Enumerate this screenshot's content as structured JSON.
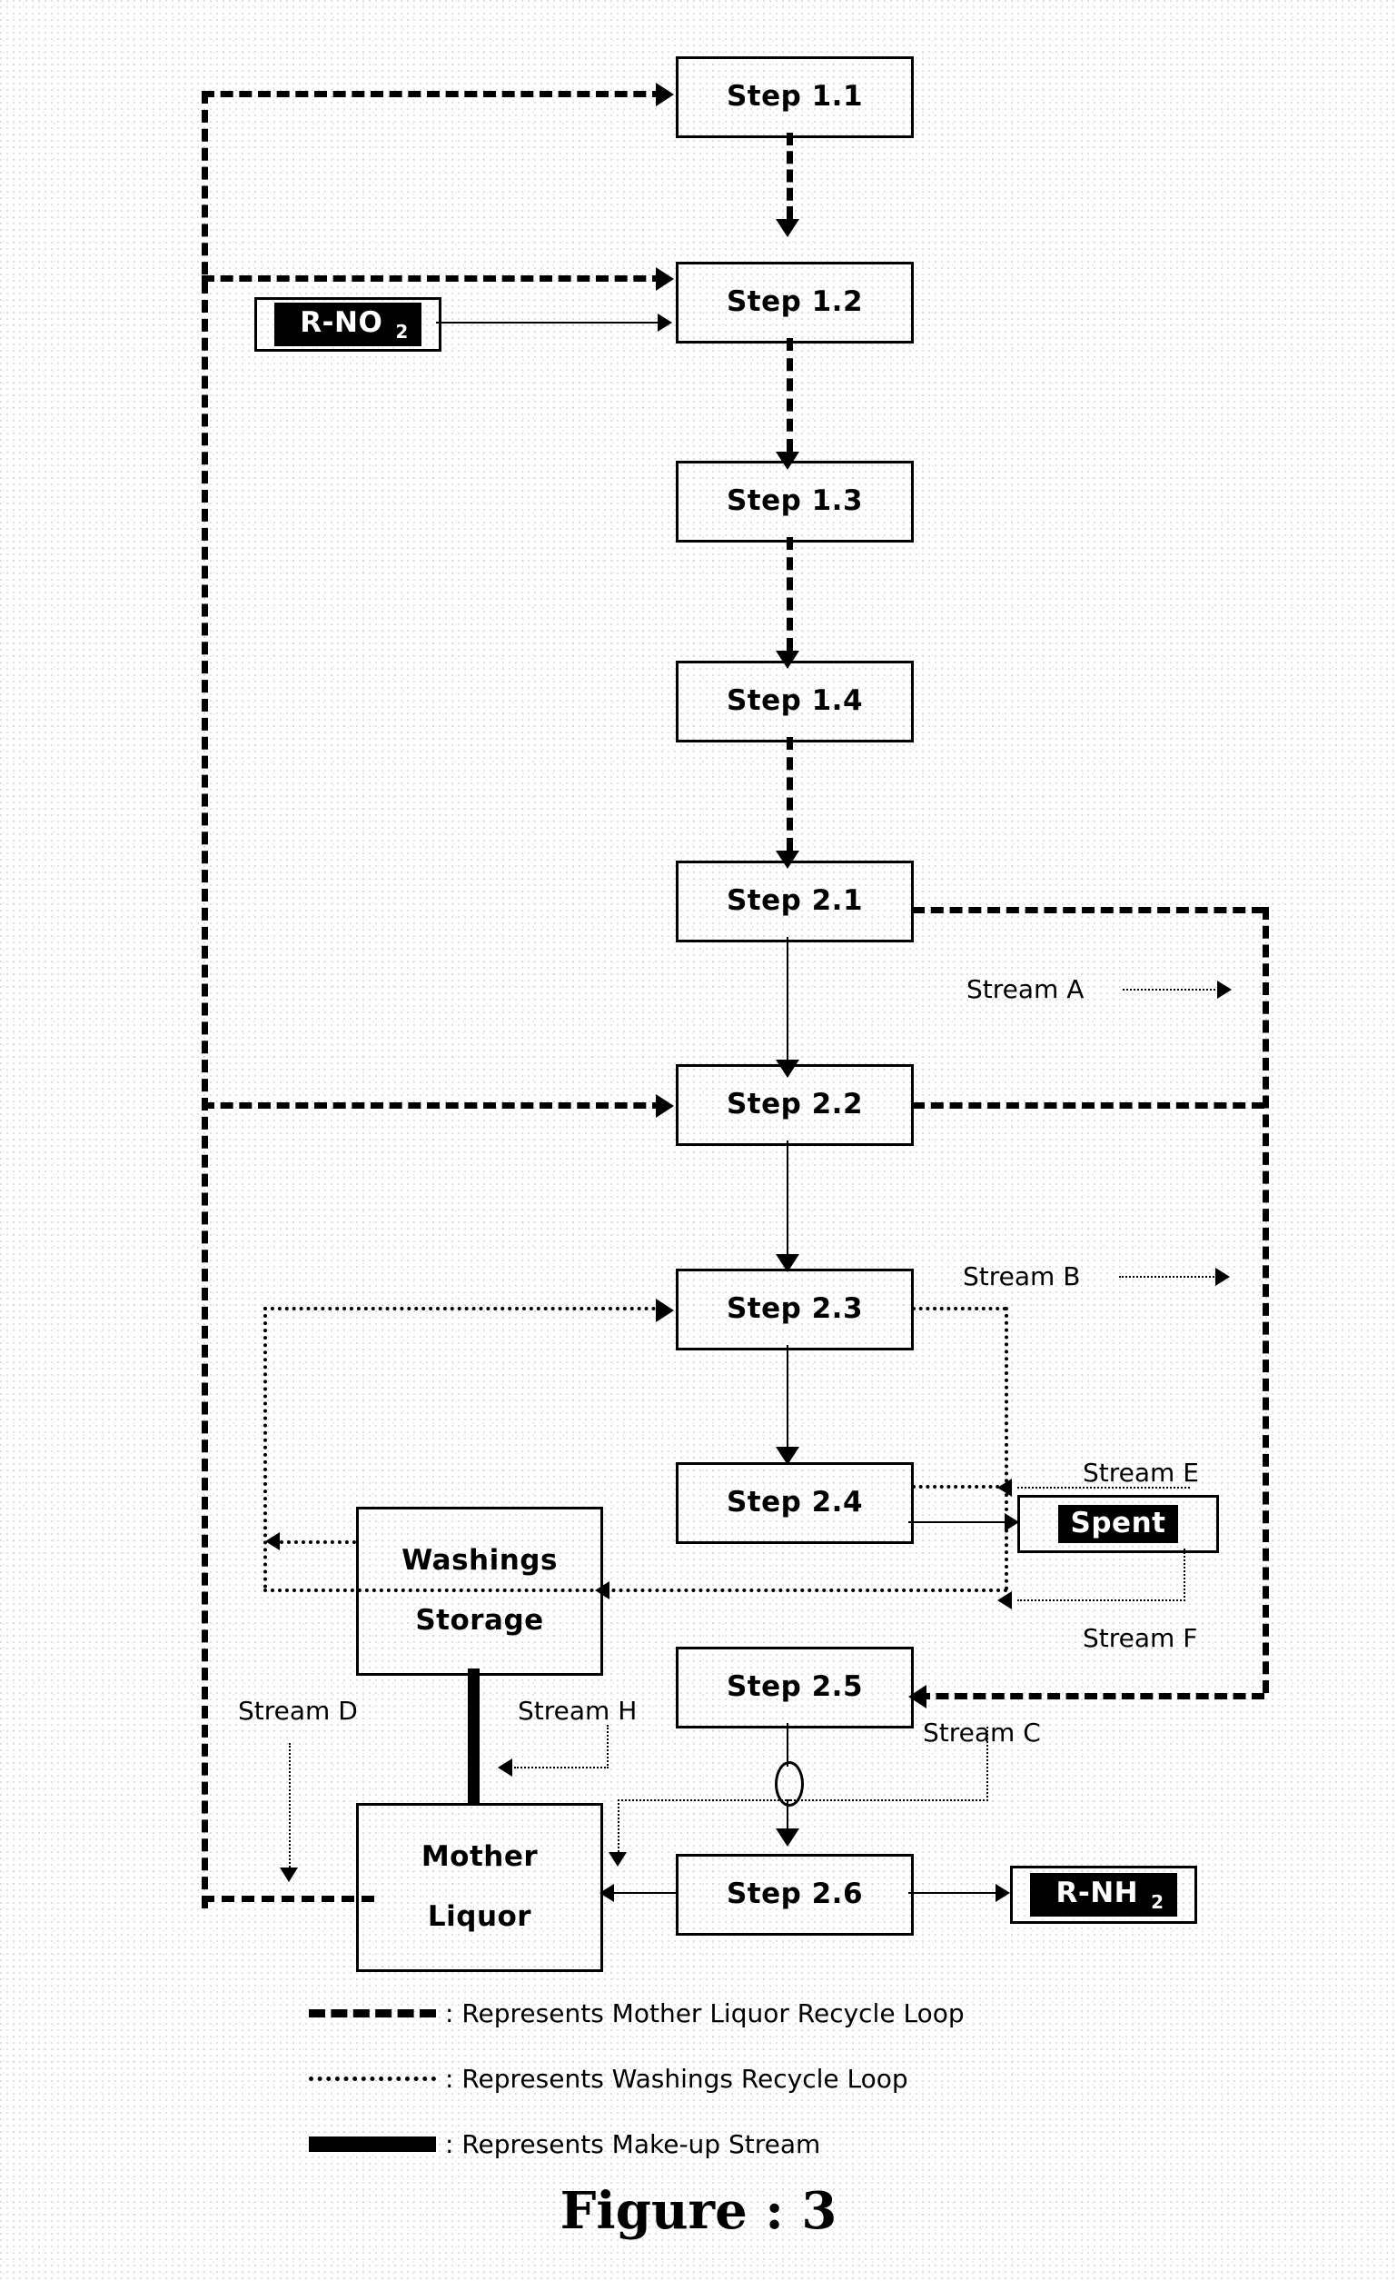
{
  "figure": {
    "caption": "Figure : 3"
  },
  "nodes": {
    "step_1_1": "Step 1.1",
    "step_1_2": "Step 1.2",
    "step_1_3": "Step 1.3",
    "step_1_4": "Step 1.4",
    "step_2_1": "Step 2.1",
    "step_2_2": "Step 2.2",
    "step_2_3": "Step 2.3",
    "step_2_4": "Step 2.4",
    "step_2_5": "Step 2.5",
    "step_2_6": "Step 2.6",
    "washings_line1": "Washings",
    "washings_line2": "Storage",
    "mother_line1": "Mother",
    "mother_line2": "Liquor",
    "spent": "Spent"
  },
  "chemicals": {
    "feed": "R-NO",
    "feed_sub": "2",
    "product": "R-NH",
    "product_sub": "2"
  },
  "streams": {
    "a": "Stream A",
    "b": "Stream B",
    "c": "Stream C",
    "d": "Stream D",
    "e": "Stream E",
    "f": "Stream F",
    "h": "Stream H"
  },
  "legend": [
    {
      "key": "dashed-line",
      "text": ": Represents Mother Liquor Recycle Loop"
    },
    {
      "key": "dotted-line",
      "text": ": Represents Washings Recycle Loop"
    },
    {
      "key": "solid-thick-line",
      "text": ": Represents Make-up Stream"
    }
  ],
  "colors": {
    "ink": "#000000",
    "paper": "#ffffff"
  }
}
